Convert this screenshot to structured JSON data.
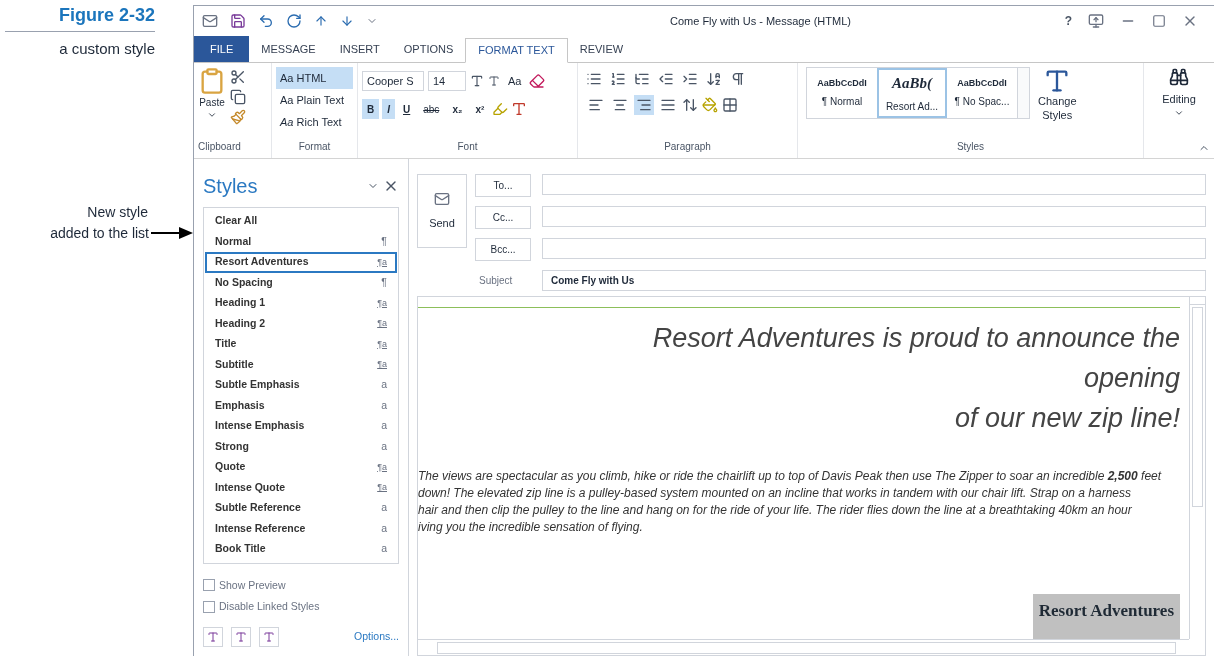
{
  "figure": {
    "label": "Figure 2-32",
    "caption": "a custom style"
  },
  "callout": {
    "lines": [
      "New style",
      "added to the list"
    ]
  },
  "window": {
    "title": "Come Fly with Us - Message (HTML)",
    "help": "?"
  },
  "tabs": [
    {
      "label": "FILE",
      "kind": "file",
      "selected": false
    },
    {
      "label": "MESSAGE",
      "kind": "tab",
      "selected": false
    },
    {
      "label": "INSERT",
      "kind": "tab",
      "selected": false
    },
    {
      "label": "OPTIONS",
      "kind": "tab",
      "selected": false
    },
    {
      "label": "FORMAT TEXT",
      "kind": "tab",
      "selected": true
    },
    {
      "label": "REVIEW",
      "kind": "tab",
      "selected": false
    }
  ],
  "clipboard": {
    "paste": "Paste",
    "group": "Clipboard"
  },
  "format": {
    "group": "Format",
    "options": [
      {
        "label": "Aa HTML",
        "selected": true
      },
      {
        "label": "Aa Plain Text",
        "selected": false
      },
      {
        "label": "*Aa* Rich Text",
        "selected": false
      }
    ]
  },
  "font": {
    "name": "Cooper S",
    "size": "14",
    "case": "Aa",
    "group": "Font",
    "buttons": [
      {
        "label": "B",
        "kind": "bold",
        "selected": true
      },
      {
        "label": "I",
        "kind": "italic",
        "selected": true
      },
      {
        "label": "U",
        "kind": "underline",
        "selected": false
      },
      {
        "label": "abc",
        "kind": "strike",
        "selected": false
      },
      {
        "label": "x₂",
        "kind": "bold",
        "selected": false
      },
      {
        "label": "x²",
        "kind": "bold",
        "selected": false
      }
    ]
  },
  "paragraph": {
    "group": "Paragraph",
    "align": [
      {
        "selected": false
      },
      {
        "selected": false
      },
      {
        "selected": true
      },
      {
        "selected": false
      }
    ]
  },
  "styles_gallery": {
    "group": "Styles",
    "change": [
      "Change",
      "Styles"
    ],
    "editing": "Editing",
    "items": [
      {
        "preview": "AaBbCcDdI",
        "name": "¶ Normal",
        "selected": false
      },
      {
        "preview": "AaBb(",
        "name": "Resort Ad...",
        "selected": true
      },
      {
        "preview": "AaBbCcDdI",
        "name": "¶ No Spac...",
        "selected": false
      }
    ]
  },
  "styles_pane": {
    "title": "Styles",
    "items": [
      {
        "name": "Clear All",
        "selected": false
      },
      {
        "name": "Normal",
        "symbol": "¶",
        "selected": false
      },
      {
        "name": "Resort Adventures",
        "symbol": "¶a",
        "selected": true
      },
      {
        "name": "No Spacing",
        "symbol": "¶",
        "selected": false
      },
      {
        "name": "Heading 1",
        "symbol": "¶a",
        "selected": false
      },
      {
        "name": "Heading 2",
        "symbol": "¶a",
        "selected": false
      },
      {
        "name": "Title",
        "symbol": "¶a",
        "selected": false
      },
      {
        "name": "Subtitle",
        "symbol": "¶a",
        "selected": false
      },
      {
        "name": "Subtle Emphasis",
        "symbol": "a",
        "selected": false
      },
      {
        "name": "Emphasis",
        "symbol": "a",
        "selected": false
      },
      {
        "name": "Intense Emphasis",
        "symbol": "a",
        "selected": false
      },
      {
        "name": "Strong",
        "symbol": "a",
        "selected": false
      },
      {
        "name": "Quote",
        "symbol": "¶a",
        "selected": false
      },
      {
        "name": "Intense Quote",
        "symbol": "¶a",
        "selected": false
      },
      {
        "name": "Subtle Reference",
        "symbol": "a",
        "selected": false
      },
      {
        "name": "Intense Reference",
        "symbol": "a",
        "selected": false
      },
      {
        "name": "Book Title",
        "symbol": "a",
        "selected": false
      }
    ],
    "options": [
      {
        "label": "Show Preview",
        "checked": false
      },
      {
        "label": "Disable Linked Styles",
        "checked": false
      }
    ],
    "link": "Options..."
  },
  "compose": {
    "send": "Send",
    "recipients": [
      "To...",
      "Cc...",
      "Bcc..."
    ],
    "subject_label": "Subject",
    "subject": "Come Fly with Us"
  },
  "body": {
    "heading": [
      "Resort Adventures is proud to announce the",
      "opening",
      "of our new zip line!"
    ],
    "paragraph": [
      "The views are spectacular as you climb, hike or ride the chairlift up to top of Davis Peak then use The Zipper to soar an incredible **2,500** feet",
      "down! The elevated zip line is a pulley-based system mounted on an incline that works in tandem with our chair lift.  Strap on a harness",
      "hair and then clip the pulley to the line and hang on for the ride of your life. The rider flies down the line at a breathtaking 40km an hour",
      "iving you the incredible sensation of flying."
    ],
    "signature": "Resort Adventures"
  }
}
